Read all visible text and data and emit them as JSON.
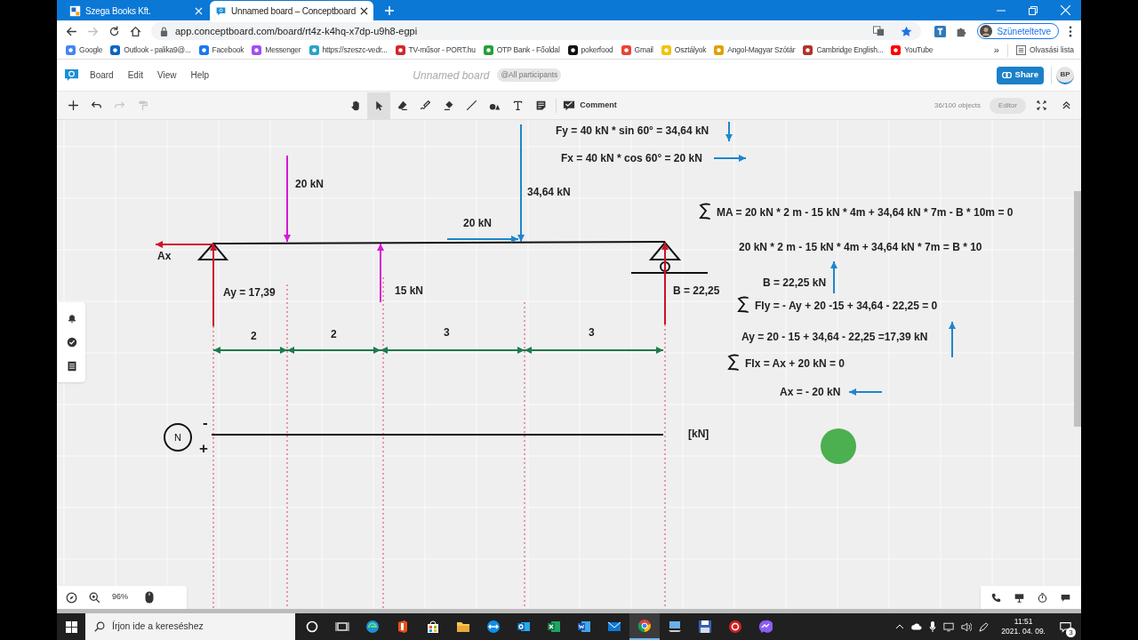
{
  "browser": {
    "tabs": [
      {
        "title": "Szega Books Kft.",
        "selected": false
      },
      {
        "title": "Unnamed board – Conceptboard",
        "selected": true
      }
    ],
    "url": "app.conceptboard.com/board/rt4z-k4hq-x7dp-u9h8-egpi",
    "profile": "Szüneteltetve",
    "bookmarks": [
      "Google",
      "Outlook - palika9@...",
      "Facebook",
      "Messenger",
      "https://szeszc-vedr...",
      "TV-műsor - PORT.hu",
      "OTP Bank - Főoldal",
      "pokerfood",
      "Gmail",
      "Osztályok",
      "Angol-Magyar Szótár",
      "Cambridge English...",
      "YouTube"
    ],
    "more_bookmarks": "»",
    "reading_list": "Olvasási lista"
  },
  "app": {
    "menu": [
      "Board",
      "Edit",
      "View",
      "Help"
    ],
    "board_title": "Unnamed board",
    "participants": "@All participants",
    "share": "Share",
    "avatar": "BP",
    "edit_tools": [
      {
        "kind": "add",
        "disabled": false
      },
      {
        "kind": "undo",
        "disabled": false
      },
      {
        "kind": "redo",
        "disabled": true
      },
      {
        "kind": "format",
        "disabled": true
      }
    ],
    "tools": [
      {
        "kind": "hand",
        "selected": false
      },
      {
        "kind": "pointer",
        "selected": true
      },
      {
        "kind": "eraser",
        "selected": false
      },
      {
        "kind": "pen",
        "selected": false
      },
      {
        "kind": "marker",
        "selected": false
      },
      {
        "kind": "line",
        "selected": false
      },
      {
        "kind": "shapes",
        "selected": false
      },
      {
        "kind": "text",
        "selected": false
      },
      {
        "kind": "sticky",
        "selected": false
      }
    ],
    "comment": "Comment",
    "objects": "36/100 objects",
    "role": "Editor",
    "zoom": "96%"
  },
  "board": {
    "labels": [
      "Fy = 40 kN * sin 60° = 34,64 kN",
      "Fx = 40 kN * cos 60° = 20 kN",
      "20 kN",
      "34,64 kN",
      "20 kN",
      "Ax",
      "Ay = 17,39",
      "15 kN",
      "B = 22,25",
      "2",
      "2",
      "3",
      "3",
      "[kN]",
      "-",
      "+"
    ],
    "diagram_label": "N",
    "equations": [
      {
        "text": "MA = 20 kN * 2 m - 15 kN * 4m + 34,64 kN * 7m - B * 10m = 0",
        "sum": true
      },
      {
        "text": "20 kN * 2 m - 15 kN * 4m + 34,64 kN * 7m = B * 10",
        "sum": false
      },
      {
        "text": "B = 22,25 kN",
        "sum": false
      },
      {
        "text": "FIy = - Ay + 20 -15 + 34,64 - 22,25 = 0",
        "sum": true
      },
      {
        "text": "Ay = 20 - 15 + 34,64 - 22,25 =17,39 kN",
        "sum": false
      },
      {
        "text": "FIx = Ax + 20 kN = 0",
        "sum": true
      },
      {
        "text": "Ax = - 20 kN",
        "sum": false
      }
    ]
  },
  "taskbar": {
    "search_placeholder": "Írjon ide a kereséshez",
    "apps": [
      {
        "kind": "circle",
        "selected": false
      },
      {
        "kind": "taskview",
        "selected": false
      },
      {
        "kind": "swirl",
        "selected": false
      },
      {
        "kind": "office",
        "selected": false
      },
      {
        "kind": "bag",
        "selected": false
      },
      {
        "kind": "folder",
        "selected": false
      },
      {
        "kind": "remote",
        "selected": false
      },
      {
        "kind": "mail",
        "selected": false
      },
      {
        "kind": "sheet",
        "selected": false
      },
      {
        "kind": "doc",
        "selected": false
      },
      {
        "kind": "envelope",
        "selected": false
      },
      {
        "kind": "browser",
        "selected": true
      },
      {
        "kind": "monitor",
        "selected": false
      },
      {
        "kind": "floppy",
        "selected": false
      },
      {
        "kind": "record",
        "selected": false
      },
      {
        "kind": "chat",
        "selected": false
      }
    ],
    "time": "11:51",
    "date": "2021. 04. 09.",
    "notifications": "3"
  }
}
